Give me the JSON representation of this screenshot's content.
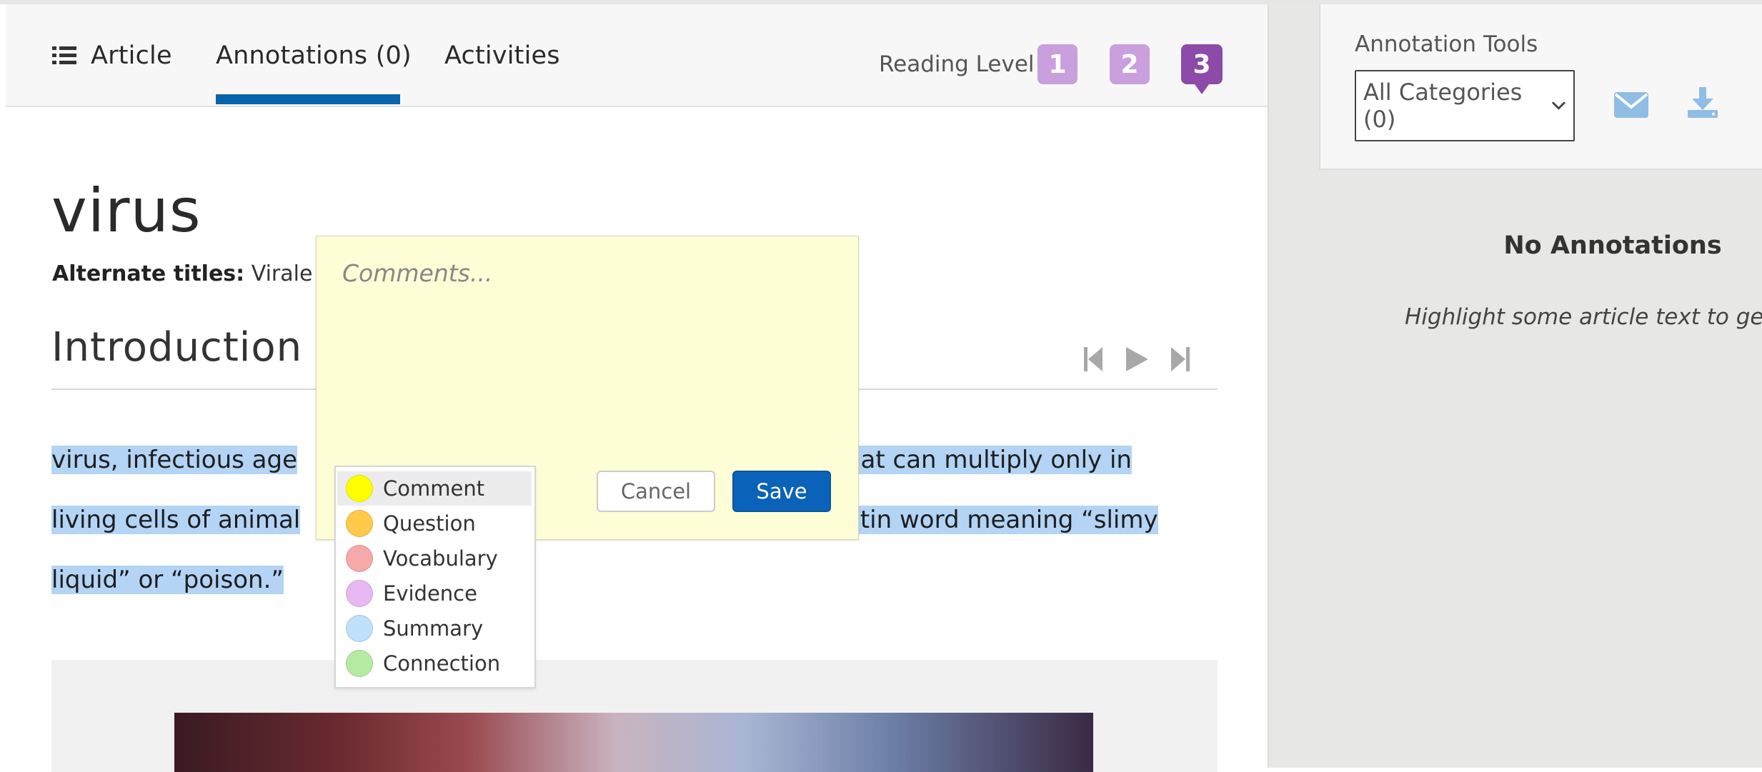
{
  "tabs": {
    "article": "Article",
    "annotations": "Annotations (0)",
    "activities": "Activities"
  },
  "reading_level": {
    "label": "Reading Level",
    "levels": [
      "1",
      "2",
      "3"
    ],
    "active": "3"
  },
  "article": {
    "title": "virus",
    "alt_label": "Alternate titles:",
    "alt_value": "Virale",
    "section_heading": "Introduction",
    "line1_left": "virus,  infectious age",
    "line1_right": "hat can multiply only in",
    "line2_left": "living cells of animal",
    "line2_right": "atin word meaning “slimy",
    "line3": "liquid” or “poison.”"
  },
  "popup": {
    "placeholder": "Comments...",
    "cancel": "Cancel",
    "save": "Save",
    "categories": [
      {
        "label": "Comment",
        "color": "#ffff00"
      },
      {
        "label": "Question",
        "color": "#ffc94a"
      },
      {
        "label": "Vocabulary",
        "color": "#f7a8a8"
      },
      {
        "label": "Evidence",
        "color": "#e8b8f2"
      },
      {
        "label": "Summary",
        "color": "#bfe1fb"
      },
      {
        "label": "Connection",
        "color": "#b4eba0"
      }
    ],
    "selected_category": "Comment"
  },
  "sidebar": {
    "tools_label": "Annotation Tools",
    "category_filter": "All Categories (0)",
    "no_annotations": "No Annotations",
    "hint": "Highlight some article text to get st"
  },
  "colors": {
    "accent": "#0a63a8",
    "level_inactive": "#c99fdd",
    "level_active": "#8d4aa8",
    "highlight": "#b3d4f5",
    "icon_blue": "#8fbde3"
  }
}
